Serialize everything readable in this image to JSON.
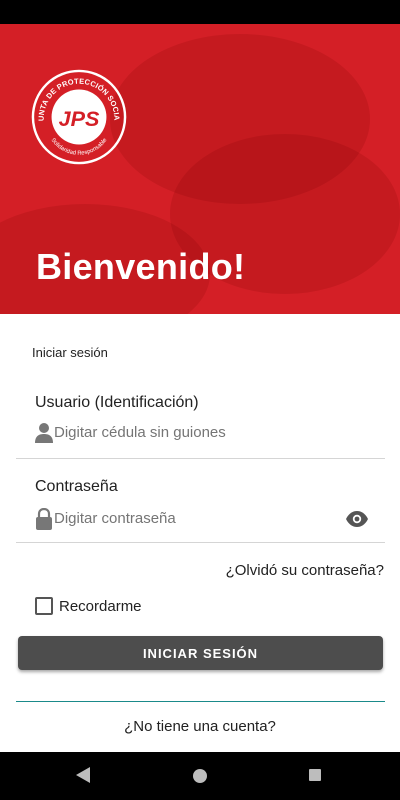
{
  "hero": {
    "title": "Bienvenido!",
    "logo": {
      "icon": "jps-logo",
      "text_top": "JUNTA DE PROTECCIÓN SOCIAL",
      "initials": "JPS",
      "text_bottom": "Solidaridad Responsable"
    }
  },
  "form": {
    "title": "Iniciar sesión",
    "username": {
      "label": "Usuario (Identificación)",
      "placeholder": "Digitar cédula sin guiones",
      "icon": "person-icon"
    },
    "password": {
      "label": "Contraseña",
      "placeholder": "Digitar contraseña",
      "icon": "lock-icon",
      "toggle_icon": "eye-icon"
    },
    "forgot_label": "¿Olvidó su contraseña?",
    "remember_label": "Recordarme",
    "remember_checked": false,
    "login_label": "INICIAR SESIÓN",
    "signup_label": "¿No tiene una cuenta?"
  },
  "navigation": {
    "back_icon": "back-triangle-icon",
    "home_icon": "home-circle-icon",
    "recent_icon": "recent-apps-square-icon"
  },
  "colors": {
    "primary_red": "#d41f26",
    "button_gray": "#4d4d4d",
    "divider_teal": "#1a8a8a"
  }
}
